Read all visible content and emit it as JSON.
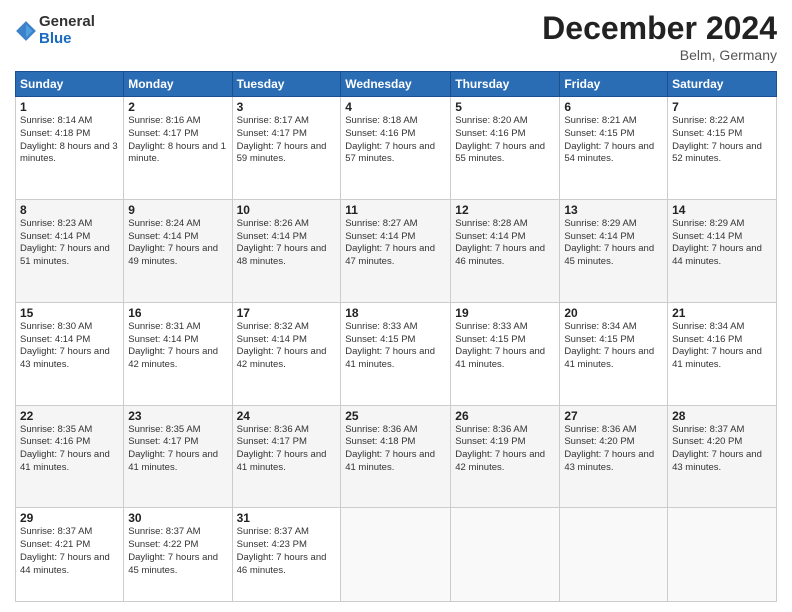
{
  "logo": {
    "general": "General",
    "blue": "Blue"
  },
  "header": {
    "month": "December 2024",
    "location": "Belm, Germany"
  },
  "weekdays": [
    "Sunday",
    "Monday",
    "Tuesday",
    "Wednesday",
    "Thursday",
    "Friday",
    "Saturday"
  ],
  "weeks": [
    [
      {
        "day": "1",
        "sunrise": "8:14 AM",
        "sunset": "4:18 PM",
        "daylight": "8 hours and 3 minutes."
      },
      {
        "day": "2",
        "sunrise": "8:16 AM",
        "sunset": "4:17 PM",
        "daylight": "8 hours and 1 minute."
      },
      {
        "day": "3",
        "sunrise": "8:17 AM",
        "sunset": "4:17 PM",
        "daylight": "7 hours and 59 minutes."
      },
      {
        "day": "4",
        "sunrise": "8:18 AM",
        "sunset": "4:16 PM",
        "daylight": "7 hours and 57 minutes."
      },
      {
        "day": "5",
        "sunrise": "8:20 AM",
        "sunset": "4:16 PM",
        "daylight": "7 hours and 55 minutes."
      },
      {
        "day": "6",
        "sunrise": "8:21 AM",
        "sunset": "4:15 PM",
        "daylight": "7 hours and 54 minutes."
      },
      {
        "day": "7",
        "sunrise": "8:22 AM",
        "sunset": "4:15 PM",
        "daylight": "7 hours and 52 minutes."
      }
    ],
    [
      {
        "day": "8",
        "sunrise": "8:23 AM",
        "sunset": "4:14 PM",
        "daylight": "7 hours and 51 minutes."
      },
      {
        "day": "9",
        "sunrise": "8:24 AM",
        "sunset": "4:14 PM",
        "daylight": "7 hours and 49 minutes."
      },
      {
        "day": "10",
        "sunrise": "8:26 AM",
        "sunset": "4:14 PM",
        "daylight": "7 hours and 48 minutes."
      },
      {
        "day": "11",
        "sunrise": "8:27 AM",
        "sunset": "4:14 PM",
        "daylight": "7 hours and 47 minutes."
      },
      {
        "day": "12",
        "sunrise": "8:28 AM",
        "sunset": "4:14 PM",
        "daylight": "7 hours and 46 minutes."
      },
      {
        "day": "13",
        "sunrise": "8:29 AM",
        "sunset": "4:14 PM",
        "daylight": "7 hours and 45 minutes."
      },
      {
        "day": "14",
        "sunrise": "8:29 AM",
        "sunset": "4:14 PM",
        "daylight": "7 hours and 44 minutes."
      }
    ],
    [
      {
        "day": "15",
        "sunrise": "8:30 AM",
        "sunset": "4:14 PM",
        "daylight": "7 hours and 43 minutes."
      },
      {
        "day": "16",
        "sunrise": "8:31 AM",
        "sunset": "4:14 PM",
        "daylight": "7 hours and 42 minutes."
      },
      {
        "day": "17",
        "sunrise": "8:32 AM",
        "sunset": "4:14 PM",
        "daylight": "7 hours and 42 minutes."
      },
      {
        "day": "18",
        "sunrise": "8:33 AM",
        "sunset": "4:15 PM",
        "daylight": "7 hours and 41 minutes."
      },
      {
        "day": "19",
        "sunrise": "8:33 AM",
        "sunset": "4:15 PM",
        "daylight": "7 hours and 41 minutes."
      },
      {
        "day": "20",
        "sunrise": "8:34 AM",
        "sunset": "4:15 PM",
        "daylight": "7 hours and 41 minutes."
      },
      {
        "day": "21",
        "sunrise": "8:34 AM",
        "sunset": "4:16 PM",
        "daylight": "7 hours and 41 minutes."
      }
    ],
    [
      {
        "day": "22",
        "sunrise": "8:35 AM",
        "sunset": "4:16 PM",
        "daylight": "7 hours and 41 minutes."
      },
      {
        "day": "23",
        "sunrise": "8:35 AM",
        "sunset": "4:17 PM",
        "daylight": "7 hours and 41 minutes."
      },
      {
        "day": "24",
        "sunrise": "8:36 AM",
        "sunset": "4:17 PM",
        "daylight": "7 hours and 41 minutes."
      },
      {
        "day": "25",
        "sunrise": "8:36 AM",
        "sunset": "4:18 PM",
        "daylight": "7 hours and 41 minutes."
      },
      {
        "day": "26",
        "sunrise": "8:36 AM",
        "sunset": "4:19 PM",
        "daylight": "7 hours and 42 minutes."
      },
      {
        "day": "27",
        "sunrise": "8:36 AM",
        "sunset": "4:20 PM",
        "daylight": "7 hours and 43 minutes."
      },
      {
        "day": "28",
        "sunrise": "8:37 AM",
        "sunset": "4:20 PM",
        "daylight": "7 hours and 43 minutes."
      }
    ],
    [
      {
        "day": "29",
        "sunrise": "8:37 AM",
        "sunset": "4:21 PM",
        "daylight": "7 hours and 44 minutes."
      },
      {
        "day": "30",
        "sunrise": "8:37 AM",
        "sunset": "4:22 PM",
        "daylight": "7 hours and 45 minutes."
      },
      {
        "day": "31",
        "sunrise": "8:37 AM",
        "sunset": "4:23 PM",
        "daylight": "7 hours and 46 minutes."
      },
      null,
      null,
      null,
      null
    ]
  ]
}
